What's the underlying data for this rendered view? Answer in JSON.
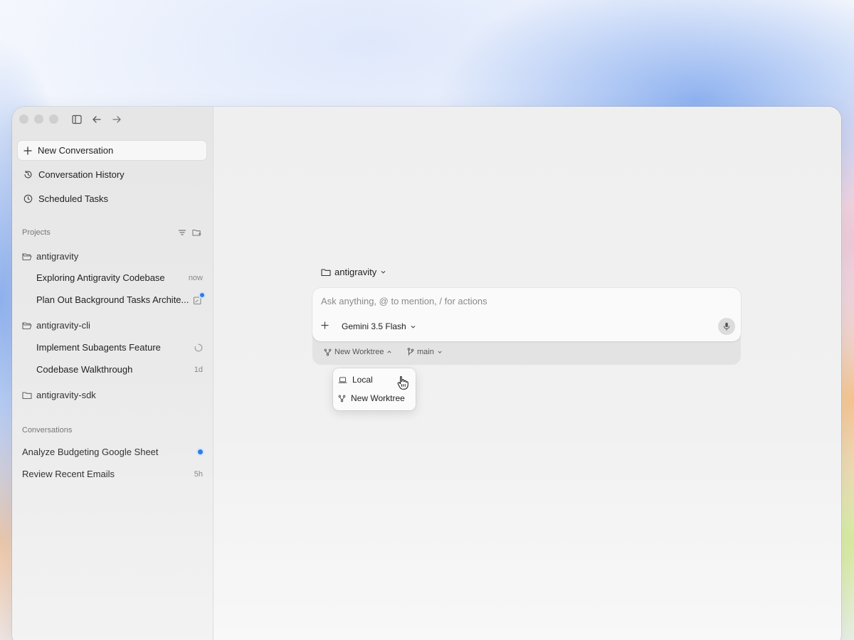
{
  "sidebar": {
    "new_conversation": "New Conversation",
    "history": "Conversation History",
    "scheduled": "Scheduled Tasks",
    "projects_label": "Projects",
    "projects": [
      {
        "name": "antigravity",
        "items": [
          {
            "title": "Exploring Antigravity Codebase",
            "meta": "now"
          },
          {
            "title": "Plan Out Background Tasks Archite...",
            "meta": ""
          }
        ]
      },
      {
        "name": "antigravity-cli",
        "items": [
          {
            "title": "Implement Subagents Feature",
            "meta": ""
          },
          {
            "title": "Codebase Walkthrough",
            "meta": "1d"
          }
        ]
      },
      {
        "name": "antigravity-sdk",
        "items": []
      }
    ],
    "conversations_label": "Conversations",
    "conversations": [
      {
        "title": "Analyze Budgeting Google Sheet",
        "meta": ""
      },
      {
        "title": "Review Recent Emails",
        "meta": "5h"
      }
    ]
  },
  "main": {
    "workspace": "antigravity",
    "composer": {
      "placeholder": "Ask anything, @ to mention, / for actions",
      "model": "Gemini 3.5 Flash"
    },
    "options": {
      "worktree": "New Worktree",
      "branch": "main"
    },
    "dropdown": {
      "items": [
        "Local",
        "New Worktree"
      ]
    }
  },
  "colors": {
    "accent_dot": "#2f7ce8"
  }
}
